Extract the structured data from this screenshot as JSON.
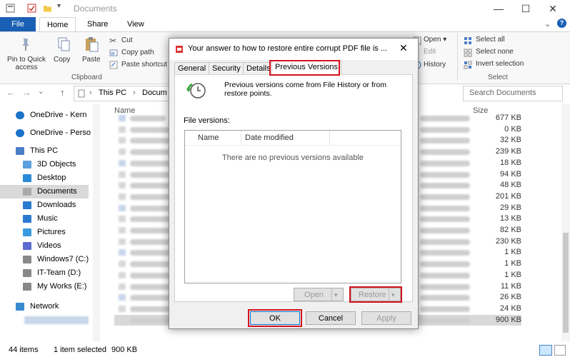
{
  "window": {
    "title": "Documents"
  },
  "ribbon_tabs": {
    "file": "File",
    "home": "Home",
    "share": "Share",
    "view": "View"
  },
  "ribbon": {
    "pin_label": "Pin to Quick",
    "pin_label2": "access",
    "copy_label": "Copy",
    "paste_label": "Paste",
    "cut_label": "Cut",
    "copy_path_label": "Copy path",
    "paste_shortcut_label": "Paste shortcut",
    "clipboard_group": "Clipboard",
    "open_label": "Open",
    "edit_label": "Edit",
    "history_label": "History",
    "select_all_label": "Select all",
    "select_none_label": "Select none",
    "invert_label": "Invert selection",
    "select_group": "Select"
  },
  "address": {
    "path_this_pc": "This PC",
    "path_docs": "Docum",
    "search_placeholder": "Search Documents"
  },
  "nav": [
    {
      "label": "OneDrive - Kern",
      "icon": "cloud-icon"
    },
    {
      "label": "OneDrive - Perso",
      "icon": "cloud-icon"
    },
    {
      "label": "This PC",
      "icon": "computer-icon"
    },
    {
      "label": "3D Objects",
      "icon": "cube-icon"
    },
    {
      "label": "Desktop",
      "icon": "desktop-icon"
    },
    {
      "label": "Documents",
      "icon": "document-icon"
    },
    {
      "label": "Downloads",
      "icon": "download-icon"
    },
    {
      "label": "Music",
      "icon": "music-icon"
    },
    {
      "label": "Pictures",
      "icon": "picture-icon"
    },
    {
      "label": "Videos",
      "icon": "video-icon"
    },
    {
      "label": "Windows7 (C:)",
      "icon": "drive-icon"
    },
    {
      "label": "IT-Team (D:)",
      "icon": "drive-icon"
    },
    {
      "label": "My Works (E:)",
      "icon": "drive-icon"
    },
    {
      "label": "Network",
      "icon": "network-icon"
    }
  ],
  "file_list": {
    "col_name": "Name",
    "col_size": "Size",
    "sizes": [
      "677 KB",
      "0 KB",
      "32 KB",
      "239 KB",
      "18 KB",
      "94 KB",
      "48 KB",
      "201 KB",
      "29 KB",
      "13 KB",
      "82 KB",
      "230 KB",
      "1 KB",
      "1 KB",
      "1 KB",
      "11 KB",
      "26 KB",
      "24 KB",
      "900 KB"
    ]
  },
  "status": {
    "items": "44 items",
    "selected": "1 item selected",
    "size": "900 KB"
  },
  "dialog": {
    "title": "Your answer to how to restore entire corrupt PDF file is ...",
    "tabs": {
      "general": "General",
      "security": "Security",
      "details": "Details",
      "previous": "Previous Versions"
    },
    "info_line1": "Previous versions come from File History or from",
    "info_line2": "restore points.",
    "file_versions_label": "File versions:",
    "col_name": "Name",
    "col_date": "Date modified",
    "empty_message": "There are no previous versions available",
    "open_button": "Open",
    "restore_button": "Restore",
    "ok_button": "OK",
    "cancel_button": "Cancel",
    "apply_button": "Apply"
  },
  "colors": {
    "accent": "#1a5fb4",
    "highlight": "#d6121c",
    "selection": "#cce8ff"
  }
}
